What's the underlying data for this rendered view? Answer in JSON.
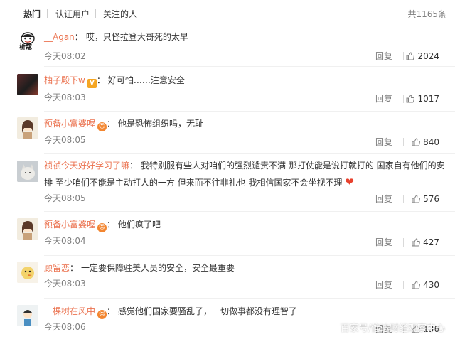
{
  "tabs": [
    {
      "label": "热门"
    },
    {
      "label": "认证用户"
    },
    {
      "label": "关注的人"
    }
  ],
  "total": "共1165条",
  "reply_label": "回复",
  "comments": [
    {
      "user": "__Agan",
      "text": "哎，只怪拉登大哥死的太早",
      "time": "今天08:02",
      "likes": "2024"
    },
    {
      "user": "柚子殿下w",
      "text": "好可怕……注意安全",
      "time": "今天08:03",
      "likes": "1017"
    },
    {
      "user": "预备小富婆喔",
      "text": "他是恐怖组织吗，无耻",
      "time": "今天08:05",
      "likes": "840"
    },
    {
      "user": "祯祯今天好好学习了嘛",
      "text": "我特别服有些人对咱们的强烈谴责不满 那打仗能是说打就打的 国家自有他们的安排 至少咱们不能是主动打人的一方 但来而不往非礼也 我相信国家不会坐视不理",
      "time": "今天08:05",
      "likes": "576"
    },
    {
      "user": "预备小富婆喔",
      "text": "他们疯了吧",
      "time": "今天08:04",
      "likes": "427"
    },
    {
      "user": "顾留恋",
      "text": "一定要保障驻美人员的安全，安全最重要",
      "time": "今天08:03",
      "likes": "430"
    },
    {
      "user": "一棵树在风中",
      "text": "感觉他们国家要骚乱了，一切做事都没有理智了",
      "time": "今天08:06",
      "likes": "136"
    }
  ],
  "avatar_text": "析蔻",
  "watermark": "百家号/信达财经观察中心",
  "colors": {
    "username": "#eb7350",
    "meta": "#808080",
    "heart": "#e8412d"
  }
}
